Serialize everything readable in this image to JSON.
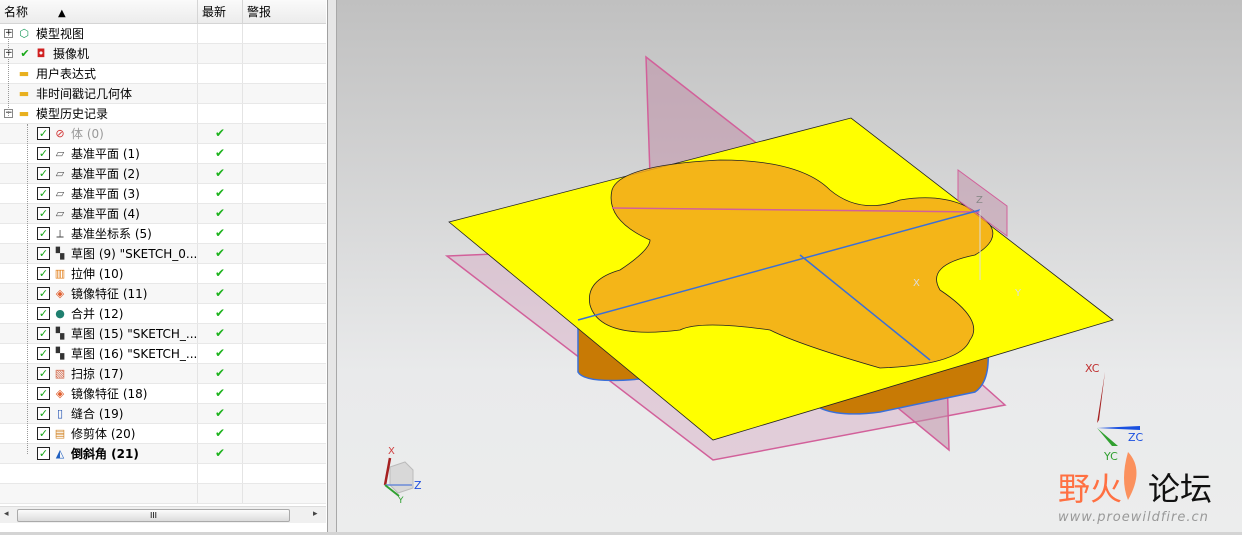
{
  "navigator": {
    "columns": {
      "name": "名称",
      "latest": "最新",
      "alert": "警报"
    },
    "sort_indicator": "▲",
    "top_items": [
      {
        "label": "模型视图",
        "icon": "model-view-icon",
        "expander": "+"
      },
      {
        "label": "摄像机",
        "icon": "camera-icon",
        "expander": "+",
        "check": "✔"
      },
      {
        "label": "用户表达式",
        "icon": "folder-icon"
      },
      {
        "label": "非时间戳记几何体",
        "icon": "folder-icon"
      },
      {
        "label": "模型历史记录",
        "icon": "folder-open-icon",
        "expander": "−"
      }
    ],
    "history": [
      {
        "label": "体 (0)",
        "icon": "body-icon",
        "latest": "✔",
        "dim": true
      },
      {
        "label": "基准平面 (1)",
        "icon": "datum-plane-icon",
        "latest": "✔"
      },
      {
        "label": "基准平面 (2)",
        "icon": "datum-plane-icon",
        "latest": "✔"
      },
      {
        "label": "基准平面 (3)",
        "icon": "datum-plane-icon",
        "latest": "✔"
      },
      {
        "label": "基准平面 (4)",
        "icon": "datum-plane-icon",
        "latest": "✔"
      },
      {
        "label": "基准坐标系 (5)",
        "icon": "datum-csys-icon",
        "latest": "✔"
      },
      {
        "label": "草图 (9) \"SKETCH_0...",
        "icon": "sketch-icon",
        "latest": "✔"
      },
      {
        "label": "拉伸 (10)",
        "icon": "extrude-icon",
        "latest": "✔"
      },
      {
        "label": "镜像特征 (11)",
        "icon": "mirror-icon",
        "latest": "✔"
      },
      {
        "label": "合并 (12)",
        "icon": "unite-icon",
        "latest": "✔"
      },
      {
        "label": "草图 (15) \"SKETCH_...",
        "icon": "sketch-icon",
        "latest": "✔"
      },
      {
        "label": "草图 (16) \"SKETCH_...",
        "icon": "sketch-icon",
        "latest": "✔"
      },
      {
        "label": "扫掠 (17)",
        "icon": "swept-icon",
        "latest": "✔"
      },
      {
        "label": "镜像特征 (18)",
        "icon": "mirror-icon",
        "latest": "✔"
      },
      {
        "label": "缝合 (19)",
        "icon": "sew-icon",
        "latest": "✔"
      },
      {
        "label": "修剪体 (20)",
        "icon": "trim-body-icon",
        "latest": "✔"
      },
      {
        "label": "倒斜角 (21)",
        "icon": "chamfer-icon",
        "latest": "✔",
        "bold": true
      }
    ],
    "scrollbar": {
      "left": "◂",
      "right": "▸",
      "grip": "III"
    }
  },
  "viewport": {
    "wcs_labels": {
      "x": "XC",
      "y": "YC",
      "z": "ZC"
    },
    "view_triad": {
      "x": "X",
      "y": "Y",
      "z": "Z"
    },
    "csys_labels": {
      "x": "X",
      "y": "Y",
      "z": "Z"
    },
    "watermark": {
      "title_a": "野火",
      "title_b": "论坛",
      "url": "www.proewildfire.cn"
    },
    "colors": {
      "sheet": "#ffff00",
      "body": "#e8940a",
      "datum": "#d2609a",
      "edge": "#3a6fd8"
    }
  }
}
